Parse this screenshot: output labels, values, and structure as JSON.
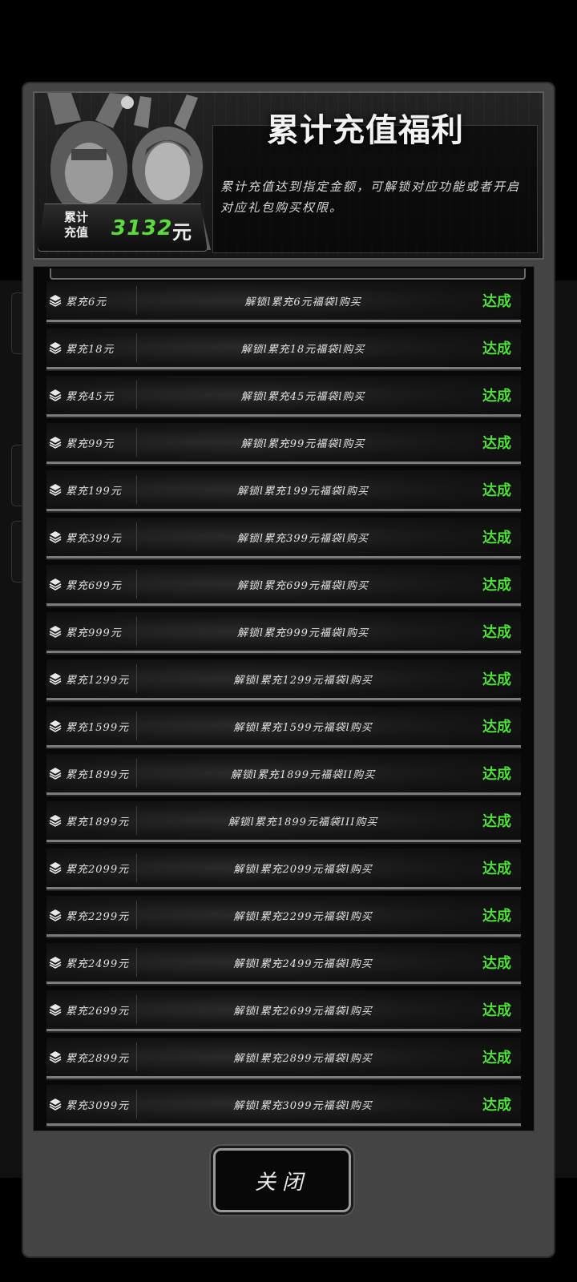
{
  "header": {
    "title": "累计充值福利",
    "description": "累计充值达到指定金额，可解锁对应功能或者开启对应礼包购买权限。",
    "total_label_line1": "累计",
    "total_label_line2": "充值",
    "total_amount": "3132",
    "total_unit": "元"
  },
  "rewards": [
    {
      "amount": "累充6元",
      "desc": "解锁l累充6元福袋l购买",
      "status": "达成"
    },
    {
      "amount": "累充18元",
      "desc": "解锁l累充18元福袋l购买",
      "status": "达成"
    },
    {
      "amount": "累充45元",
      "desc": "解锁l累充45元福袋l购买",
      "status": "达成"
    },
    {
      "amount": "累充99元",
      "desc": "解锁l累充99元福袋l购买",
      "status": "达成"
    },
    {
      "amount": "累充199元",
      "desc": "解锁l累充199元福袋l购买",
      "status": "达成"
    },
    {
      "amount": "累充399元",
      "desc": "解锁l累充399元福袋l购买",
      "status": "达成"
    },
    {
      "amount": "累充699元",
      "desc": "解锁l累充699元福袋l购买",
      "status": "达成"
    },
    {
      "amount": "累充999元",
      "desc": "解锁l累充999元福袋l购买",
      "status": "达成"
    },
    {
      "amount": "累充1299元",
      "desc": "解锁l累充1299元福袋l购买",
      "status": "达成"
    },
    {
      "amount": "累充1599元",
      "desc": "解锁l累充1599元福袋l购买",
      "status": "达成"
    },
    {
      "amount": "累充1899元",
      "desc": "解锁l累充1899元福袋II购买",
      "status": "达成"
    },
    {
      "amount": "累充1899元",
      "desc": "解锁l累充1899元福袋III购买",
      "status": "达成"
    },
    {
      "amount": "累充2099元",
      "desc": "解锁l累充2099元福袋l购买",
      "status": "达成"
    },
    {
      "amount": "累充2299元",
      "desc": "解锁l累充2299元福袋l购买",
      "status": "达成"
    },
    {
      "amount": "累充2499元",
      "desc": "解锁l累充2499元福袋l购买",
      "status": "达成"
    },
    {
      "amount": "累充2699元",
      "desc": "解锁l累充2699元福袋l购买",
      "status": "达成"
    },
    {
      "amount": "累充2899元",
      "desc": "解锁l累充2899元福袋l购买",
      "status": "达成"
    },
    {
      "amount": "累充3099元",
      "desc": "解锁l累充3099元福袋l购买",
      "status": "达成"
    }
  ],
  "icons": {
    "row_icon": "layers-stack-icon"
  },
  "colors": {
    "status_green": "#4fe13a",
    "total_green": "#5bdc3c"
  },
  "close_label": "关闭"
}
